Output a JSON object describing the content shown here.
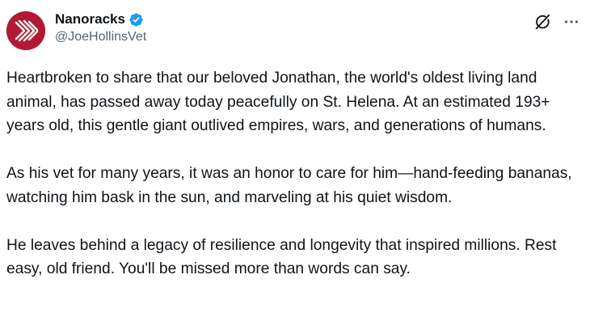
{
  "author": {
    "display_name": "Nanoracks",
    "handle": "@JoeHollinsVet",
    "verified": true,
    "avatar_color": "#b01a34",
    "verified_color": "#1d9bf0"
  },
  "header_icons": {
    "grok": "grok-icon",
    "more": "more-icon"
  },
  "post": {
    "paragraphs": [
      "Heartbroken to share that our beloved Jonathan, the world's oldest living land animal, has passed away today peacefully on St. Helena. At an estimated 193+ years old, this gentle giant outlived empires, wars, and generations of humans.",
      "As his vet for many years, it was an honor to care for him—hand-feeding bananas, watching him bask in the sun, and marveling at his quiet wisdom.",
      "He leaves behind a legacy of resilience and longevity that inspired millions. Rest easy, old friend. You'll be missed more than words can say."
    ]
  }
}
